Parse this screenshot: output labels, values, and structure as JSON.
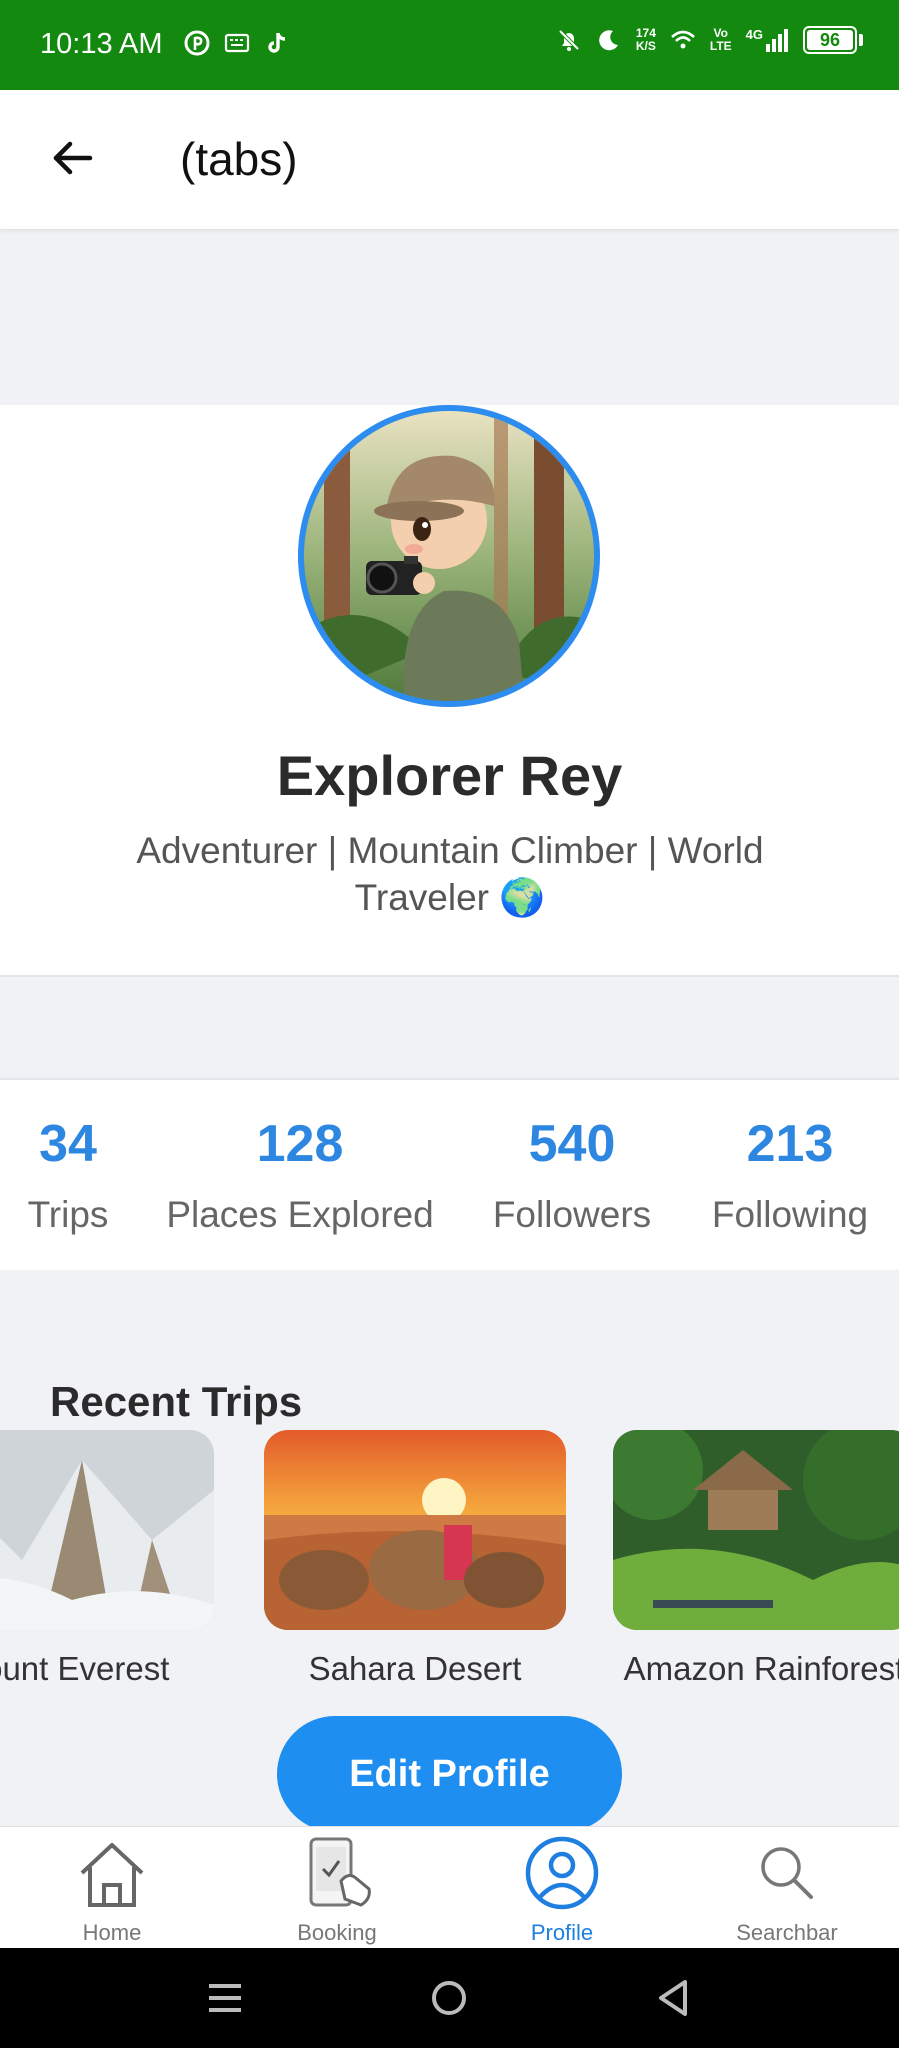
{
  "status_bar": {
    "time": "10:13 AM",
    "left_icons": [
      "pinterest-icon",
      "keyboard-icon",
      "tiktok-icon"
    ],
    "net_speed_value": "174",
    "net_speed_unit": "K/S",
    "volte_top": "Vo",
    "volte_bottom": "LTE",
    "network": "4G",
    "battery": "96",
    "bg_color": "#138a0f"
  },
  "header": {
    "title": "(tabs)"
  },
  "profile": {
    "name": "Explorer Rey",
    "bio": "Adventurer | Mountain Climber | World Traveler 🌍",
    "accent_color": "#2d8cf0"
  },
  "stats": [
    {
      "value": "34",
      "label": "Trips"
    },
    {
      "value": "128",
      "label": "Places Explored"
    },
    {
      "value": "540",
      "label": "Followers"
    },
    {
      "value": "213",
      "label": "Following"
    }
  ],
  "recent_trips": {
    "title": "Recent Trips",
    "items": [
      {
        "label": "Mount Everest"
      },
      {
        "label": "Sahara Desert"
      },
      {
        "label": "Amazon Rainforest"
      }
    ]
  },
  "edit_profile_label": "Edit Profile",
  "bottom_nav": {
    "items": [
      {
        "label": "Home",
        "icon": "home-icon",
        "active": false
      },
      {
        "label": "Booking",
        "icon": "booking-icon",
        "active": false
      },
      {
        "label": "Profile",
        "icon": "profile-icon",
        "active": true
      },
      {
        "label": "Searchbar",
        "icon": "search-icon",
        "active": false
      }
    ],
    "active_color": "#1e7fe0"
  }
}
